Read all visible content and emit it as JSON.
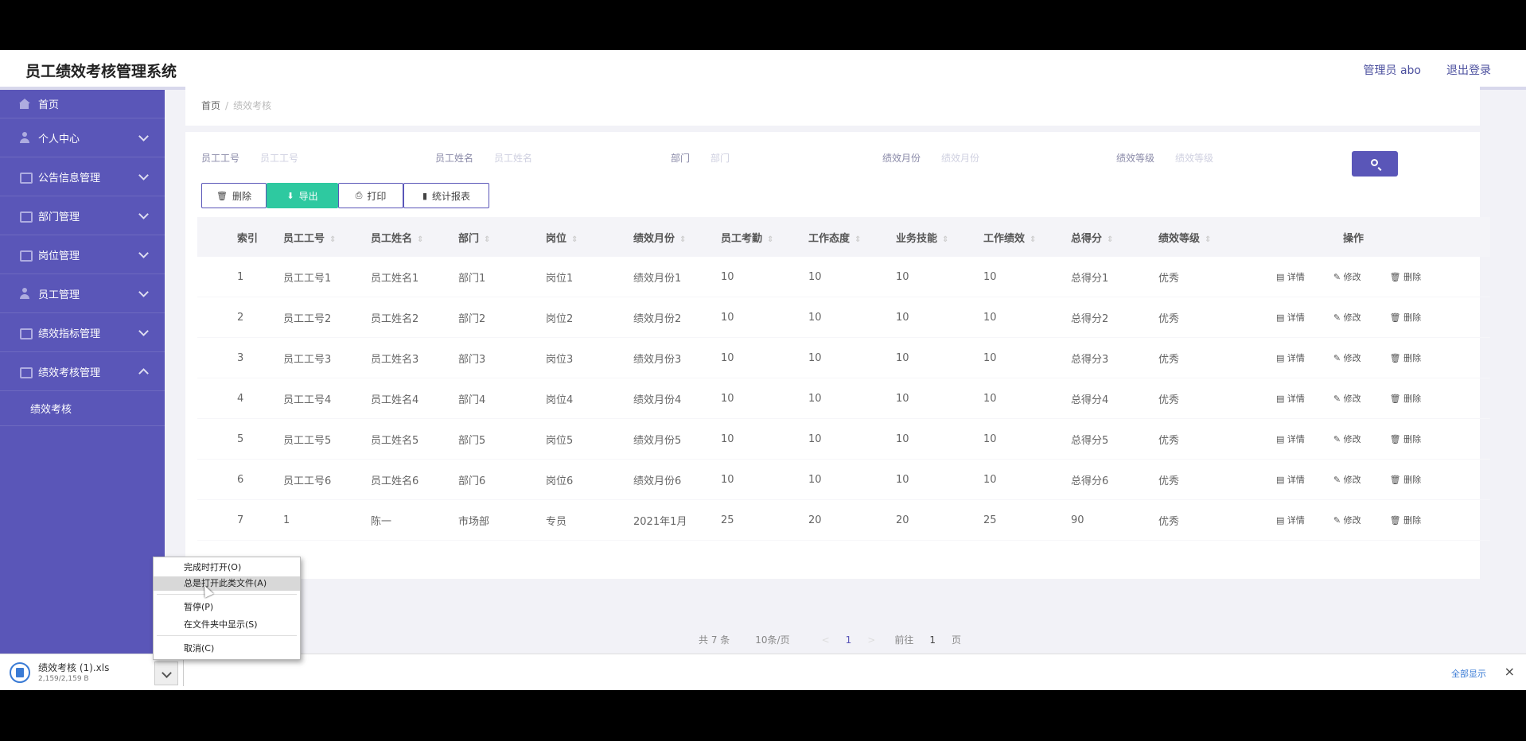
{
  "header": {
    "title": "员工绩效考核管理系统",
    "user": "管理员 abo",
    "logout": "退出登录"
  },
  "sidebar": {
    "items": [
      {
        "label": "首页",
        "icon": "home-icon",
        "expand": "none"
      },
      {
        "label": "个人中心",
        "icon": "user-icon",
        "expand": "down"
      },
      {
        "label": "公告信息管理",
        "icon": "notice-icon",
        "expand": "down"
      },
      {
        "label": "部门管理",
        "icon": "department-icon",
        "expand": "down"
      },
      {
        "label": "岗位管理",
        "icon": "position-icon",
        "expand": "down"
      },
      {
        "label": "员工管理",
        "icon": "staff-icon",
        "expand": "down"
      },
      {
        "label": "绩效指标管理",
        "icon": "indicator-icon",
        "expand": "down"
      },
      {
        "label": "绩效考核管理",
        "icon": "assessment-icon",
        "expand": "up"
      }
    ],
    "sub_item": "绩效考核"
  },
  "breadcrumb": {
    "home": "首页",
    "sep": "/",
    "current": "绩效考核"
  },
  "search": {
    "fields": [
      {
        "label": "员工工号",
        "placeholder": "员工工号"
      },
      {
        "label": "员工姓名",
        "placeholder": "员工姓名"
      },
      {
        "label": "部门",
        "placeholder": "部门"
      },
      {
        "label": "绩效月份",
        "placeholder": "绩效月份"
      },
      {
        "label": "绩效等级",
        "placeholder": "绩效等级"
      }
    ]
  },
  "toolbar": {
    "delete": "删除",
    "export": "导出",
    "print": "打印",
    "report": "统计报表"
  },
  "table": {
    "headers": [
      "索引",
      "员工工号",
      "员工姓名",
      "部门",
      "岗位",
      "绩效月份",
      "员工考勤",
      "工作态度",
      "业务技能",
      "工作绩效",
      "总得分",
      "绩效等级",
      "操作"
    ],
    "rows": [
      [
        "1",
        "员工工号1",
        "员工姓名1",
        "部门1",
        "岗位1",
        "绩效月份1",
        "10",
        "10",
        "10",
        "10",
        "总得分1",
        "优秀"
      ],
      [
        "2",
        "员工工号2",
        "员工姓名2",
        "部门2",
        "岗位2",
        "绩效月份2",
        "10",
        "10",
        "10",
        "10",
        "总得分2",
        "优秀"
      ],
      [
        "3",
        "员工工号3",
        "员工姓名3",
        "部门3",
        "岗位3",
        "绩效月份3",
        "10",
        "10",
        "10",
        "10",
        "总得分3",
        "优秀"
      ],
      [
        "4",
        "员工工号4",
        "员工姓名4",
        "部门4",
        "岗位4",
        "绩效月份4",
        "10",
        "10",
        "10",
        "10",
        "总得分4",
        "优秀"
      ],
      [
        "5",
        "员工工号5",
        "员工姓名5",
        "部门5",
        "岗位5",
        "绩效月份5",
        "10",
        "10",
        "10",
        "10",
        "总得分5",
        "优秀"
      ],
      [
        "6",
        "员工工号6",
        "员工姓名6",
        "部门6",
        "岗位6",
        "绩效月份6",
        "10",
        "10",
        "10",
        "10",
        "总得分6",
        "优秀"
      ],
      [
        "7",
        "1",
        "陈一",
        "市场部",
        "专员",
        "2021年1月",
        "25",
        "20",
        "20",
        "25",
        "90",
        "优秀"
      ]
    ],
    "actions": {
      "detail": "详情",
      "edit": "修改",
      "delete": "删除"
    }
  },
  "pager": {
    "total": "共 7 条",
    "page_size": "10条/页",
    "prev": "<",
    "current": "1",
    "next": ">",
    "goto_label": "前往",
    "goto_value": "1",
    "page_suffix": "页"
  },
  "download": {
    "file_name": "绩效考核 (1).xls",
    "size": "2,159/2,159 B",
    "show_all": "全部显示",
    "close": "×"
  },
  "context_menu": {
    "items": [
      "完成时打开(O)",
      "总是打开此类文件(A)",
      "暂停(P)",
      "在文件夹中显示(S)",
      "取消(C)"
    ]
  },
  "colors": {
    "sidebar": "#5a56b8",
    "accent": "#5a56b8",
    "export_green": "#2ec9a0",
    "link_blue": "#3a7bd5"
  }
}
